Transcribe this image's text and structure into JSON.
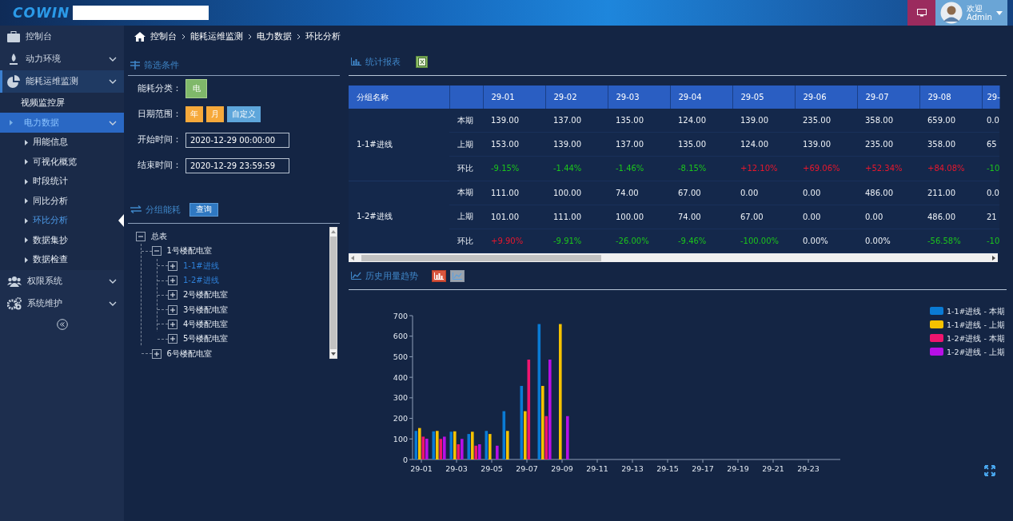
{
  "header": {
    "logo": "COWIN",
    "welcome": "欢迎",
    "user": "Admin"
  },
  "sidebar": {
    "items": [
      {
        "label": "控制台",
        "selected": false,
        "expandable": false
      },
      {
        "label": "动力环境",
        "selected": false,
        "expandable": true
      },
      {
        "label": "能耗运维监测",
        "selected": true,
        "expandable": true,
        "children": [
          {
            "label": "视频监控屏",
            "selected": false,
            "expandable": false
          },
          {
            "label": "电力数据",
            "selected": true,
            "expandable": true,
            "children": [
              {
                "label": "用能信息",
                "selected": false
              },
              {
                "label": "可视化概览",
                "selected": false
              },
              {
                "label": "时段统计",
                "selected": false
              },
              {
                "label": "同比分析",
                "selected": false
              },
              {
                "label": "环比分析",
                "selected": true
              },
              {
                "label": "数据集抄",
                "selected": false
              },
              {
                "label": "数据检查",
                "selected": false
              }
            ]
          }
        ]
      },
      {
        "label": "权限系统",
        "selected": false,
        "expandable": true
      },
      {
        "label": "系统维护",
        "selected": false,
        "expandable": true
      }
    ]
  },
  "breadcrumb": [
    "控制台",
    "能耗运维监测",
    "电力数据",
    "环比分析"
  ],
  "filter": {
    "title": "筛选条件",
    "category": {
      "label": "能耗分类：",
      "options": [
        {
          "label": "电",
          "selected": true
        }
      ]
    },
    "date_range": {
      "label": "日期范围：",
      "options": [
        {
          "label": "年",
          "selected": false
        },
        {
          "label": "月",
          "selected": false
        },
        {
          "label": "自定义",
          "selected": true
        }
      ]
    },
    "start": {
      "label": "开始时间：",
      "value": "2020-12-29 00:00:00"
    },
    "end": {
      "label": "结束时间：",
      "value": "2020-12-29 23:59:59"
    }
  },
  "group": {
    "title": "分组能耗",
    "button": "查询"
  },
  "tree": {
    "nodes": [
      {
        "label": "总表",
        "expanded": true,
        "selected": false,
        "children": [
          {
            "label": "1号楼配电室",
            "expanded": true,
            "selected": false,
            "children": [
              {
                "label": "1-1#进线",
                "expanded": false,
                "selected": true
              },
              {
                "label": "1-2#进线",
                "expanded": false,
                "selected": true
              },
              {
                "label": "2号楼配电室",
                "expanded": false,
                "selected": false
              },
              {
                "label": "3号楼配电室",
                "expanded": false,
                "selected": false
              },
              {
                "label": "4号楼配电室",
                "expanded": false,
                "selected": false
              },
              {
                "label": "5号楼配电室",
                "expanded": false,
                "selected": false
              }
            ]
          },
          {
            "label": "6号楼配电室",
            "expanded": false,
            "selected": false
          }
        ]
      }
    ]
  },
  "report": {
    "title": "统计报表",
    "columns": [
      "分组名称",
      "29-01",
      "29-02",
      "29-03",
      "29-04",
      "29-05",
      "29-06",
      "29-07",
      "29-08",
      "29-"
    ],
    "groups": [
      {
        "name": "1-1#进线",
        "rows": [
          {
            "label": "本期",
            "kind": "value",
            "cells": [
              "139.00",
              "137.00",
              "135.00",
              "124.00",
              "139.00",
              "235.00",
              "358.00",
              "659.00",
              "0.0"
            ]
          },
          {
            "label": "上期",
            "kind": "value",
            "cells": [
              "153.00",
              "139.00",
              "137.00",
              "135.00",
              "124.00",
              "139.00",
              "235.00",
              "358.00",
              "65"
            ]
          },
          {
            "label": "环比",
            "kind": "ratio",
            "cells": [
              {
                "text": "-9.15%",
                "color": "#1cc41c"
              },
              {
                "text": "-1.44%",
                "color": "#1cc41c"
              },
              {
                "text": "-1.46%",
                "color": "#1cc41c"
              },
              {
                "text": "-8.15%",
                "color": "#1cc41c"
              },
              {
                "text": "+12.10%",
                "color": "#e8172d"
              },
              {
                "text": "+69.06%",
                "color": "#e8172d"
              },
              {
                "text": "+52.34%",
                "color": "#e8172d"
              },
              {
                "text": "+84.08%",
                "color": "#e8172d"
              },
              {
                "text": "-10",
                "color": "#1cc41c"
              }
            ]
          }
        ]
      },
      {
        "name": "1-2#进线",
        "rows": [
          {
            "label": "本期",
            "kind": "value",
            "cells": [
              "111.00",
              "100.00",
              "74.00",
              "67.00",
              "0.00",
              "0.00",
              "486.00",
              "211.00",
              "0.0"
            ]
          },
          {
            "label": "上期",
            "kind": "value",
            "cells": [
              "101.00",
              "111.00",
              "100.00",
              "74.00",
              "67.00",
              "0.00",
              "0.00",
              "486.00",
              "21"
            ]
          },
          {
            "label": "环比",
            "kind": "ratio",
            "cells": [
              {
                "text": "+9.90%",
                "color": "#e8172d"
              },
              {
                "text": "-9.91%",
                "color": "#1cc41c"
              },
              {
                "text": "-26.00%",
                "color": "#1cc41c"
              },
              {
                "text": "-9.46%",
                "color": "#1cc41c"
              },
              {
                "text": "-100.00%",
                "color": "#1cc41c"
              },
              {
                "text": "0.00%"
              },
              {
                "text": "0.00%"
              },
              {
                "text": "-56.58%",
                "color": "#1cc41c"
              },
              {
                "text": "-10",
                "color": "#1cc41c"
              }
            ]
          }
        ]
      }
    ]
  },
  "trend": {
    "title": "历史用量趋势",
    "modes": [
      {
        "kind": "bar",
        "selected": true
      },
      {
        "kind": "line",
        "selected": false
      }
    ],
    "chart_data": {
      "type": "bar",
      "categories": [
        "29-01",
        null,
        "29-03",
        null,
        "29-05",
        null,
        "29-07",
        null,
        "29-09",
        null,
        "29-11",
        null,
        "29-13",
        null,
        "29-15",
        null,
        "29-17",
        null,
        "29-19",
        null,
        "29-21",
        null,
        "29-23",
        null
      ],
      "series": [
        {
          "name": "1-1#进线 - 本期",
          "color": "#0a7bd4",
          "values": [
            139,
            137,
            135,
            124,
            139,
            235,
            358,
            659,
            0,
            0,
            0,
            0,
            0,
            0,
            0,
            0,
            0,
            0,
            0,
            0,
            0,
            0,
            0,
            0
          ]
        },
        {
          "name": "1-1#进线 - 上期",
          "color": "#f5c200",
          "values": [
            153,
            139,
            137,
            135,
            124,
            139,
            235,
            358,
            659,
            0,
            0,
            0,
            0,
            0,
            0,
            0,
            0,
            0,
            0,
            0,
            0,
            0,
            0,
            0
          ]
        },
        {
          "name": "1-2#进线 - 本期",
          "color": "#f0156e",
          "values": [
            111,
            100,
            74,
            67,
            0,
            0,
            486,
            211,
            0,
            0,
            0,
            0,
            0,
            0,
            0,
            0,
            0,
            0,
            0,
            0,
            0,
            0,
            0,
            0
          ]
        },
        {
          "name": "1-2#进线 - 上期",
          "color": "#b70fe6",
          "values": [
            101,
            111,
            100,
            74,
            67,
            0,
            0,
            486,
            211,
            0,
            0,
            0,
            0,
            0,
            0,
            0,
            0,
            0,
            0,
            0,
            0,
            0,
            0,
            0
          ]
        }
      ],
      "ylim": [
        0,
        700
      ],
      "yticks": [
        0,
        100,
        200,
        300,
        400,
        500,
        600,
        700
      ],
      "legend": "right"
    }
  }
}
